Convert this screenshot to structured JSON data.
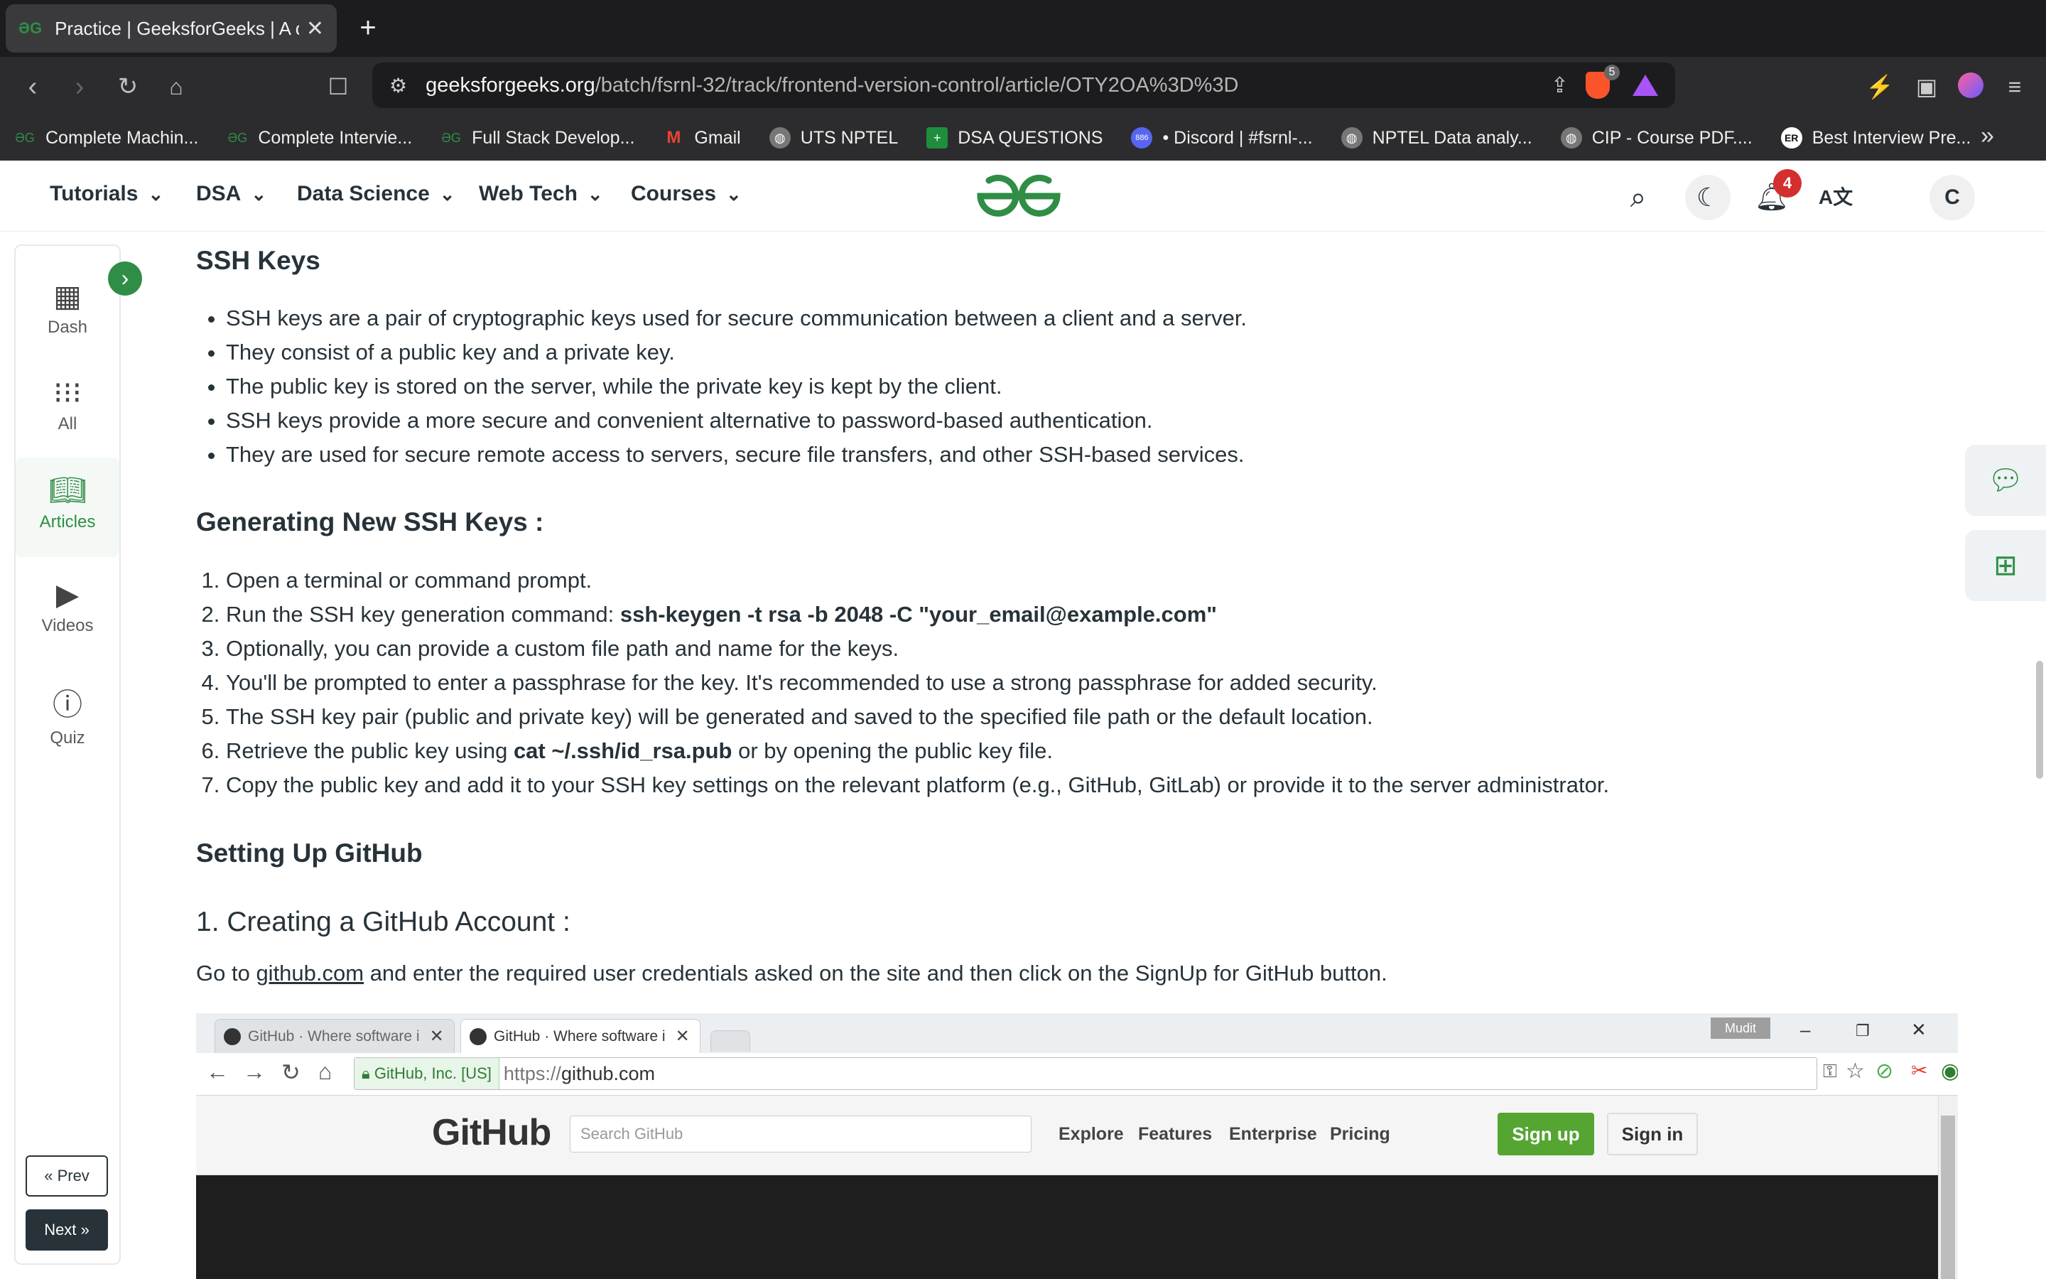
{
  "browser": {
    "tab_title": "Practice | GeeksforGeeks | A c",
    "url_host": "geeksforgeeks.org",
    "url_path": "/batch/fsrnl-32/track/frontend-version-control/article/OTY2OA%3D%3D",
    "shield_count": "5",
    "bookmarks": [
      {
        "label": "Complete Machin...",
        "icon": "gfg-icon"
      },
      {
        "label": "Complete Intervie...",
        "icon": "gfg-icon"
      },
      {
        "label": "Full Stack Develop...",
        "icon": "gfg-icon"
      },
      {
        "label": "Gmail",
        "icon": "gmail-icon"
      },
      {
        "label": "UTS NPTEL",
        "icon": "globe-icon"
      },
      {
        "label": "DSA QUESTIONS",
        "icon": "sheets-icon"
      },
      {
        "label": "• Discord | #fsrnl-...",
        "icon": "discord-icon"
      },
      {
        "label": "NPTEL Data analy...",
        "icon": "globe-icon"
      },
      {
        "label": "CIP - Course PDF....",
        "icon": "globe-icon"
      },
      {
        "label": "Best Interview Pre...",
        "icon": "er-icon"
      }
    ],
    "discord_badge": "886",
    "er_badge": "ER"
  },
  "header": {
    "menus": [
      "Tutorials",
      "DSA",
      "Data Science",
      "Web Tech",
      "Courses"
    ],
    "notification_count": "4",
    "avatar_letter": "C"
  },
  "sidebar": {
    "items": [
      "Dash",
      "All",
      "Articles",
      "Videos",
      "Quiz"
    ],
    "active": "Articles",
    "prev_label": "Prev",
    "next_label": "Next"
  },
  "article": {
    "ssh_heading": "SSH Keys",
    "ssh_points": [
      "SSH keys are a pair of cryptographic keys used for secure communication between a client and a server.",
      "They consist of a public key and a private key.",
      "The public key is stored on the server, while the private key is kept by the client.",
      "SSH keys provide a more secure and convenient alternative to password-based authentication.",
      "They are used for secure remote access to servers, secure file transfers, and other SSH-based services."
    ],
    "gen_heading": "Generating New SSH Keys :",
    "gen_steps": [
      {
        "pre": "Open a terminal or command prompt.",
        "code": "",
        "post": ""
      },
      {
        "pre": "Run the SSH key generation command: ",
        "code": "ssh-keygen -t rsa -b 2048 -C \"your_email@example.com\"",
        "post": ""
      },
      {
        "pre": "Optionally, you can provide a custom file path and name for the keys.",
        "code": "",
        "post": ""
      },
      {
        "pre": "You'll be prompted to enter a passphrase for the key. It's recommended to use a strong passphrase for added security.",
        "code": "",
        "post": ""
      },
      {
        "pre": "The SSH key pair (public and private key) will be generated and saved to the specified file path or the default location.",
        "code": "",
        "post": ""
      },
      {
        "pre": "Retrieve the public key using ",
        "code": "cat ~/.ssh/id_rsa.pub",
        "post": " or by opening the public key file."
      },
      {
        "pre": "Copy the public key and add it to your SSH key settings on the relevant platform (e.g., GitHub, GitLab) or provide it to the server administrator.",
        "code": "",
        "post": ""
      }
    ],
    "github_heading": "Setting Up GitHub",
    "account_heading": "1. Creating a GitHub Account :",
    "para_pre": "Go to ",
    "para_link": "github.com",
    "para_post": " and enter the required user credentials asked on the site and then click on the SignUp for GitHub button."
  },
  "screenshot": {
    "tab1": "GitHub · Where software i",
    "tab2": "GitHub · Where software i",
    "user": "Mudit",
    "ev_cert": "GitHub, Inc. [US]",
    "url_proto": "https://",
    "url_host": "github.com",
    "logo": "GitHub",
    "search_placeholder": "Search GitHub",
    "links": [
      "Explore",
      "Features",
      "Enterprise",
      "Pricing"
    ],
    "signup": "Sign up",
    "signin": "Sign in"
  }
}
